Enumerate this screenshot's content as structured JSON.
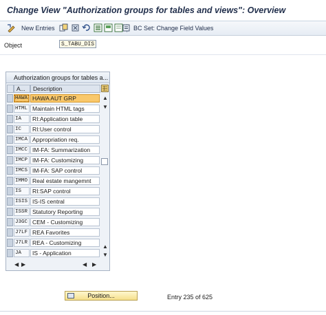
{
  "window": {
    "title": "Change View \"Authorization groups for tables and views\": Overview"
  },
  "toolbar": {
    "new_entries_label": "New Entries",
    "bc_set_label": "BC Set: Change Field Values"
  },
  "object": {
    "label": "Object",
    "value": "S_TABU_DIS"
  },
  "table": {
    "title": "Authorization groups for tables a...",
    "col_code": "A...",
    "col_desc": "Description",
    "rows": [
      {
        "code": "HAWA",
        "desc": "HAWA AUT GRP"
      },
      {
        "code": "HTML",
        "desc": "Maintain HTML tags"
      },
      {
        "code": "IA",
        "desc": "RI:Application table"
      },
      {
        "code": "IC",
        "desc": "RI:User control"
      },
      {
        "code": "IMCA",
        "desc": "Appropriation req."
      },
      {
        "code": "IMCC",
        "desc": "IM-FA: Summarization"
      },
      {
        "code": "IMCP",
        "desc": "IM-FA: Customizing"
      },
      {
        "code": "IMCS",
        "desc": "IM-FA: SAP control"
      },
      {
        "code": "IMMO",
        "desc": "Real estate mangemnt"
      },
      {
        "code": "IS",
        "desc": "RI:SAP control"
      },
      {
        "code": "ISIS",
        "desc": "IS-IS central"
      },
      {
        "code": "ISSR",
        "desc": "Statutory Reporting"
      },
      {
        "code": "J3GC",
        "desc": "CEM - Customizing"
      },
      {
        "code": "J7LF",
        "desc": "REA Favorites"
      },
      {
        "code": "J7LR",
        "desc": "REA - Customizing"
      },
      {
        "code": "JA",
        "desc": "IS - Application"
      }
    ]
  },
  "footer": {
    "position_label": "Position...",
    "entry_text": "Entry 235 of 625"
  },
  "colors": {
    "selected_row": "#f9c86b",
    "title_text": "#1f2d4a",
    "toolbar_bg": "#e6ecf4"
  }
}
